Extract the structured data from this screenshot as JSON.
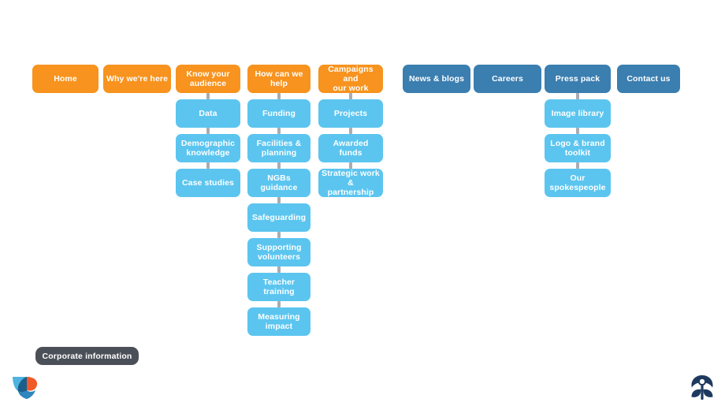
{
  "page": {
    "title": "Website sitemap",
    "background_color": "#ffffff"
  },
  "colors": {
    "primary_orange": "#F7931E",
    "secondary_dark_blue": "#3B7EB0",
    "child_light_blue": "#5BC5EF",
    "connector_gray": "#a7adb3",
    "footer_pill_gray": "#4b5058",
    "logo_navy": "#1F3A5F",
    "logo_orange": "#F05A28",
    "logo_mid_blue": "#1B5E8C",
    "logo_light_blue": "#4FB3DF"
  },
  "sitemap": {
    "columns": [
      {
        "id": "home",
        "root": {
          "label": "Home",
          "style": "orange"
        },
        "children": []
      },
      {
        "id": "why-were-here",
        "root": {
          "label": "Why we're here",
          "style": "orange"
        },
        "children": []
      },
      {
        "id": "know-your-audience",
        "root": {
          "label": "Know your\naudience",
          "style": "orange"
        },
        "children": [
          {
            "label": "Data"
          },
          {
            "label": "Demographic\nknowledge"
          },
          {
            "label": "Case studies"
          }
        ]
      },
      {
        "id": "how-can-we-help",
        "root": {
          "label": "How can we\nhelp",
          "style": "orange"
        },
        "children": [
          {
            "label": "Funding"
          },
          {
            "label": "Facilities &\nplanning"
          },
          {
            "label": "NGBs guidance"
          },
          {
            "label": "Safeguarding"
          },
          {
            "label": "Supporting\nvolunteers"
          },
          {
            "label": "Teacher\ntraining"
          },
          {
            "label": "Measuring\nimpact"
          }
        ]
      },
      {
        "id": "campaigns-and-our-work",
        "root": {
          "label": "Campaigns and\nour work",
          "style": "orange"
        },
        "children": [
          {
            "label": "Projects"
          },
          {
            "label": "Awarded funds"
          },
          {
            "label": "Strategic work &\npartnership"
          }
        ]
      },
      {
        "id": "news-and-blogs",
        "root": {
          "label": "News & blogs",
          "style": "dark-blue"
        },
        "children": []
      },
      {
        "id": "careers",
        "root": {
          "label": "Careers",
          "style": "dark-blue"
        },
        "children": []
      },
      {
        "id": "press-pack",
        "root": {
          "label": "Press pack",
          "style": "dark-blue"
        },
        "children": [
          {
            "label": "Image library"
          },
          {
            "label": "Logo & brand\ntoolkit"
          },
          {
            "label": "Our\nspokespeople"
          }
        ]
      },
      {
        "id": "contact-us",
        "root": {
          "label": "Contact us",
          "style": "dark-blue"
        },
        "children": []
      }
    ]
  },
  "footer": {
    "corporate_information_label": "Corporate information",
    "left_logo": "flower-petal-logo",
    "right_logo": "person-emblem-logo"
  }
}
